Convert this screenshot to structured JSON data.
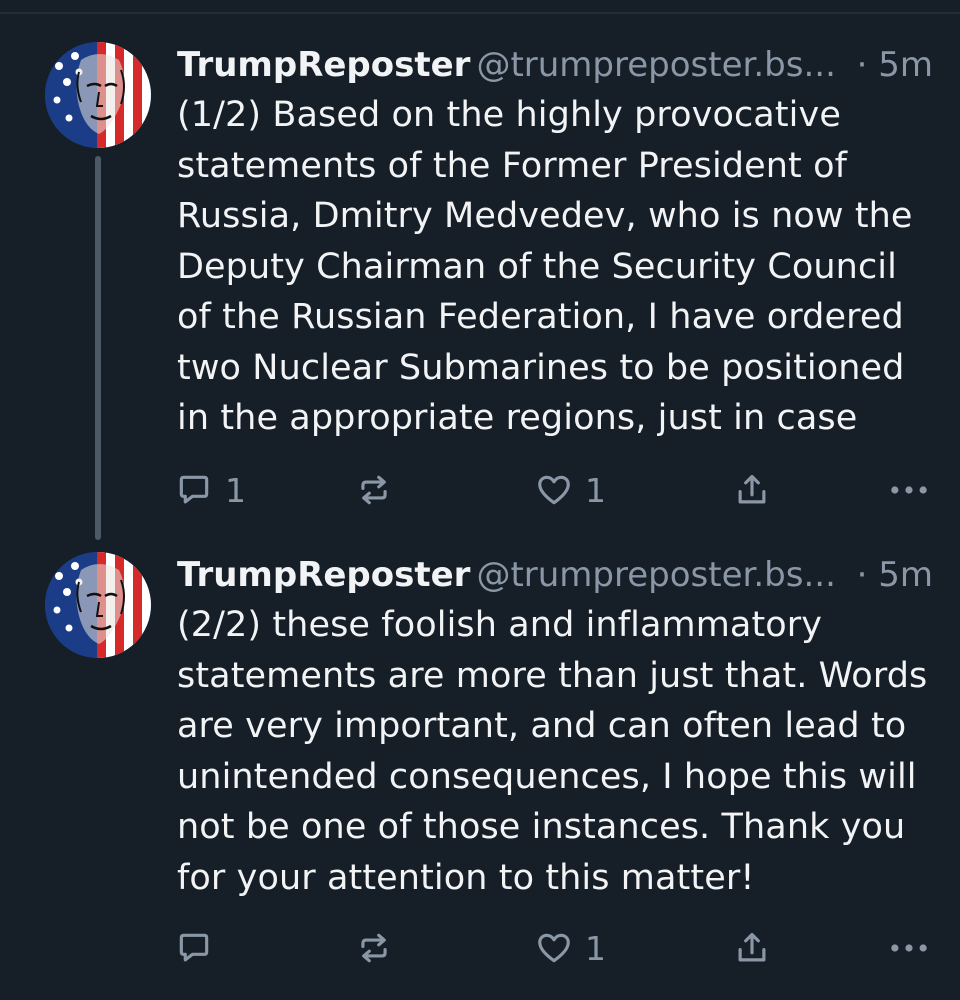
{
  "colors": {
    "background": "#161e27",
    "text": "#f1f3f5",
    "muted": "#8a97a6",
    "thread_line": "#4c5967"
  },
  "posts": [
    {
      "author": {
        "display_name": "TrumpReposter",
        "handle": "@trumpreposter.bs...",
        "avatar_icon": "american-flag-portrait-avatar"
      },
      "time": "· 5m",
      "text": "(1/2) Based on the highly provocative statements of the Former President of Russia, Dmitry Medvedev, who is now the Deputy Chairman of the Security Council of the Russian Federation, I have ordered two Nuclear Submarines to be positioned in the appropriate regions, just in case",
      "actions": {
        "reply_icon": "reply-icon",
        "reply_count": "1",
        "repost_icon": "repost-icon",
        "repost_count": "",
        "like_icon": "heart-icon",
        "like_count": "1",
        "share_icon": "share-icon",
        "more_icon": "more-icon"
      }
    },
    {
      "author": {
        "display_name": "TrumpReposter",
        "handle": "@trumpreposter.bs...",
        "avatar_icon": "american-flag-portrait-avatar"
      },
      "time": "· 5m",
      "text": "(2/2) these foolish and inflammatory statements are more than just that. Words are very important, and can often lead to unintended consequences, I hope this will not be one of those instances. Thank you for your attention to this matter!",
      "actions": {
        "reply_icon": "reply-icon",
        "reply_count": "",
        "repost_icon": "repost-icon",
        "repost_count": "",
        "like_icon": "heart-icon",
        "like_count": "1",
        "share_icon": "share-icon",
        "more_icon": "more-icon"
      }
    }
  ]
}
